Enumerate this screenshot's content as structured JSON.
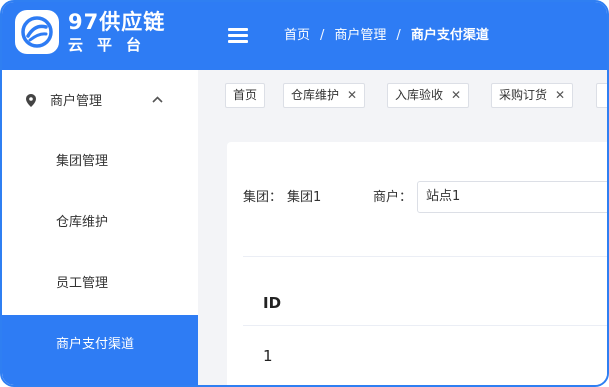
{
  "brand": {
    "name": "97供应链",
    "subtitle": "云平台"
  },
  "header": {
    "breadcrumb": [
      "首页",
      "商户管理",
      "商户支付渠道"
    ],
    "separator": "/"
  },
  "sidebar": {
    "group": {
      "label": "商户管理",
      "icon": "location-pin-icon"
    },
    "items": [
      {
        "label": "集团管理",
        "active": false
      },
      {
        "label": "仓库维护",
        "active": false
      },
      {
        "label": "员工管理",
        "active": false
      },
      {
        "label": "商户支付渠道",
        "active": true
      }
    ]
  },
  "tabs": [
    {
      "label": "首页",
      "closable": false
    },
    {
      "label": "仓库维护",
      "closable": true
    },
    {
      "label": "入库验收",
      "closable": true
    },
    {
      "label": "采购订货",
      "closable": true
    }
  ],
  "filters": {
    "group_label": "集团：",
    "group_value": "集团1",
    "merchant_label": "商户：",
    "merchant_value": "站点1"
  },
  "table": {
    "columns": [
      "ID"
    ],
    "rows": [
      [
        "1"
      ]
    ]
  },
  "colors": {
    "accent": "#2e7cf4",
    "background": "#f3f4f7"
  }
}
